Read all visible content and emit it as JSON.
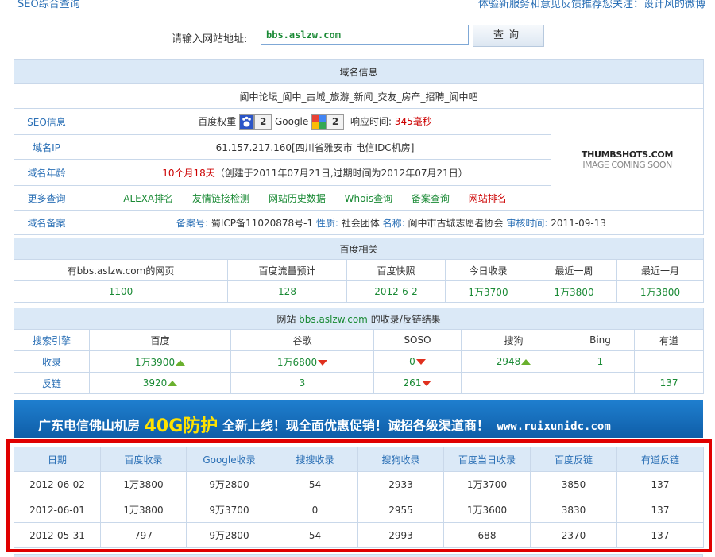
{
  "topbar": {
    "left": "SEO综合查询",
    "right": "体验新服务和意见反馈推荐您关注：设计风的微博"
  },
  "search": {
    "label": "请输入网站地址:",
    "value": "bbs.aslzw.com",
    "button": "查询"
  },
  "domain": {
    "header": "域名信息",
    "site_title": "阆中论坛_阆中_古城_旅游_新闻_交友_房产_招聘_阆中吧",
    "seo_label": "SEO信息",
    "baidu_weight_label": "百度权重",
    "baidu_weight": "2",
    "google_label": "Google",
    "google_pr": "2",
    "response_label": "响应时间:",
    "response_value": "345毫秒",
    "ip_label": "域名IP",
    "ip_value": "61.157.217.160[四川省雅安市 电信IDC机房]",
    "age_label": "域名年龄",
    "age_value": "10个月18天",
    "age_detail": "（创建于2011年07月21日,过期时间为2012年07月21日）",
    "more_label": "更多查询",
    "more_links": [
      "ALEXA排名",
      "友情链接检测",
      "网站历史数据",
      "Whois查询",
      "备案查询",
      "网站排名"
    ],
    "icp_label": "域名备案",
    "icp_no_label": "备案号:",
    "icp_no": "蜀ICP备11020878号-1",
    "nature_label": "性质:",
    "nature": "社会团体",
    "name_label": "名称:",
    "name": "阆中市古城志愿者协会",
    "audit_label": "审核时间:",
    "audit": "2011-09-13",
    "thumb_line1": "THUMBSHOTS.COM",
    "thumb_line2": "IMAGE COMING SOON"
  },
  "baidu": {
    "header": "百度相关",
    "columns": [
      "有bbs.aslzw.com的网页",
      "百度流量预计",
      "百度快照",
      "今日收录",
      "最近一周",
      "最近一月"
    ],
    "values": [
      "1100",
      "128",
      "2012-6-2",
      "1万3700",
      "1万3800",
      "1万3800"
    ]
  },
  "index": {
    "header_prefix": "网站",
    "header_site": "bbs.aslzw.com",
    "header_suffix": "的收录/反链结果",
    "columns": [
      "搜索引擎",
      "百度",
      "谷歌",
      "SOSO",
      "搜狗",
      "Bing",
      "有道"
    ],
    "row1": [
      "收录",
      "1万3900",
      "1万6800",
      "0",
      "2948",
      "1",
      ""
    ],
    "row2": [
      "反链",
      "3920",
      "3",
      "261",
      "",
      "",
      "137"
    ]
  },
  "banner": {
    "part1": "广东电信佛山机房",
    "highlight": "40G防护",
    "part2": "全新上线！现全面优惠促销！诚招各级渠道商！",
    "url": "www.ruixunidc.com"
  },
  "history": {
    "columns": [
      "日期",
      "百度收录",
      "Google收录",
      "搜搜收录",
      "搜狗收录",
      "百度当日收录",
      "百度反链",
      "有道反链"
    ],
    "rows": [
      [
        "2012-06-02",
        "1万3800",
        "9万2800",
        "54",
        "2933",
        "1万3700",
        "3850",
        "137"
      ],
      [
        "2012-06-01",
        "1万3800",
        "9万3700",
        "0",
        "2955",
        "1万3600",
        "3830",
        "137"
      ],
      [
        "2012-05-31",
        "797",
        "9万2800",
        "54",
        "2993",
        "688",
        "2370",
        "137"
      ]
    ]
  },
  "colors": {
    "header_bg": "#dbe9f7",
    "border": "#c9d8ea",
    "link_blue": "#2a6fb5",
    "green": "#1a8a35",
    "red": "#cc0000",
    "highlight_box": "#e00000"
  }
}
